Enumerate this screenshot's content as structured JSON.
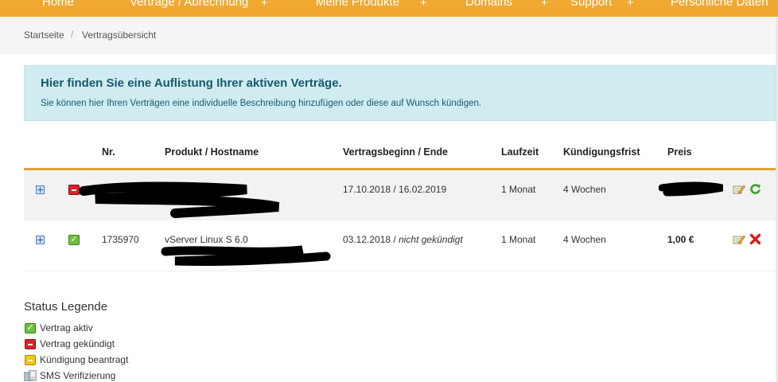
{
  "nav": {
    "items": [
      "Home",
      "Verträge / Abrechnung",
      "Meine Produkte",
      "Domains",
      "Support",
      "Persönliche Daten"
    ],
    "plus": "+"
  },
  "breadcrumb": {
    "home": "Startseite",
    "sep": "/",
    "current": "Vertragsübersicht"
  },
  "info": {
    "title": "Hier finden Sie eine Auflistung Ihrer aktiven Verträge.",
    "text": "Sie können hier Ihren Verträgen eine individuelle Beschreibung hinzufügen oder diese auf Wunsch kündigen."
  },
  "table": {
    "headers": {
      "nr": "Nr.",
      "product": "Produkt / Hostname",
      "period": "Vertragsbeginn / Ende",
      "term": "Laufzeit",
      "notice": "Kündigungsfrist",
      "price": "Preis"
    },
    "rows": [
      {
        "status": "gekündigt",
        "nr": "",
        "product": "",
        "start": "17.10.2018 / 16.02.2019",
        "end": "",
        "term": "1 Monat",
        "notice": "4 Wochen",
        "price": ""
      },
      {
        "status": "aktiv",
        "nr": "1735970",
        "product": "vServer Linux S 6.0",
        "start": "03.12.2018 / ",
        "end": "nicht gekündigt",
        "term": "1 Monat",
        "notice": "4 Wochen",
        "price": "1,00 €"
      }
    ]
  },
  "legend": {
    "title": "Status Legende",
    "items": [
      "Vertrag aktiv",
      "Vertrag gekündigt",
      "Kündigung beantragt",
      "SMS Verifizierung"
    ]
  },
  "colors": {
    "nav": "#f0a830",
    "accent": "#e5a13b",
    "info_bg": "#d1ecf1",
    "info_text": "#155a6c"
  }
}
